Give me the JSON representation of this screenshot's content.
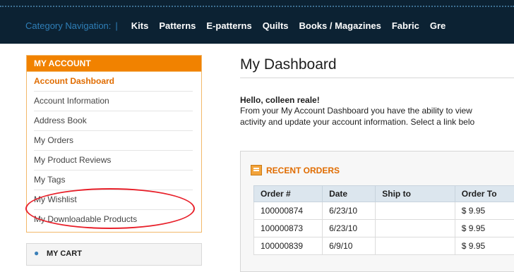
{
  "nav": {
    "category_label": "Category Navigation:",
    "separator": "|",
    "items": [
      "Kits",
      "Patterns",
      "E-patterns",
      "Quilts",
      "Books / Magazines",
      "Fabric",
      "Gre"
    ]
  },
  "sidebar": {
    "account_title": "MY ACCOUNT",
    "items": [
      {
        "label": "Account Dashboard",
        "active": true
      },
      {
        "label": "Account Information"
      },
      {
        "label": "Address Book"
      },
      {
        "label": "My Orders"
      },
      {
        "label": "My Product Reviews"
      },
      {
        "label": "My Tags"
      },
      {
        "label": "My Wishlist"
      },
      {
        "label": "My Downloadable Products"
      }
    ],
    "cart_title": "MY CART"
  },
  "main": {
    "title": "My Dashboard",
    "hello": "Hello, colleen reale!",
    "intro_line1": "From your My Account Dashboard you have the ability to view",
    "intro_line2": "activity and update your account information. Select a link belo"
  },
  "orders": {
    "title": "RECENT ORDERS",
    "columns": [
      "Order #",
      "Date",
      "Ship to",
      "Order To"
    ],
    "rows": [
      [
        "100000874",
        "6/23/10",
        "",
        "$ 9.95"
      ],
      [
        "100000873",
        "6/23/10",
        "",
        "$ 9.95"
      ],
      [
        "100000839",
        "6/9/10",
        "",
        "$ 9.95"
      ]
    ]
  },
  "colors": {
    "nav_bg": "#0c2233",
    "accent_orange": "#f18200",
    "highlight_ellipse": "#e8202a"
  }
}
